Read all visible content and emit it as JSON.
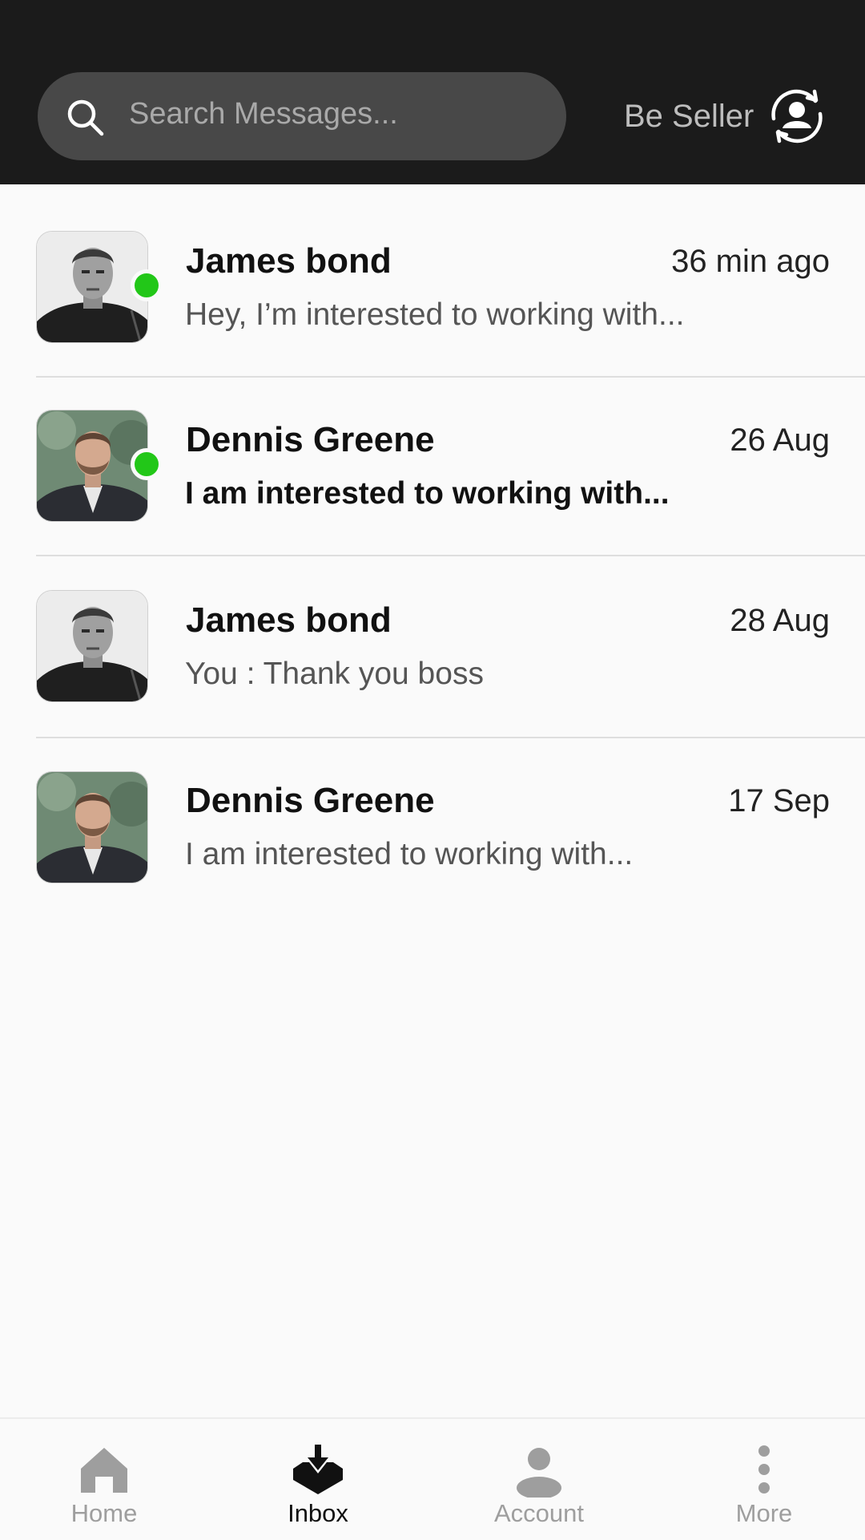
{
  "header": {
    "search_placeholder": "Search Messages...",
    "seller_label": "Be Seller"
  },
  "conversations": [
    {
      "name": "James bond",
      "time": "36 min ago",
      "preview": "Hey, I’m interested to working with...",
      "online": true,
      "unread": false,
      "avatar": "james-bond"
    },
    {
      "name": "Dennis Greene",
      "time": "26 Aug",
      "preview": "I am interested to working with...",
      "online": true,
      "unread": true,
      "avatar": "dennis-greene"
    },
    {
      "name": "James bond",
      "time": "28 Aug",
      "preview": "You : Thank you boss",
      "online": false,
      "unread": false,
      "avatar": "james-bond"
    },
    {
      "name": "Dennis Greene",
      "time": "17 Sep",
      "preview": "I am interested to working with...",
      "online": false,
      "unread": false,
      "avatar": "dennis-greene"
    }
  ],
  "bottom_nav": {
    "items": [
      {
        "label": "Home",
        "icon": "home-icon",
        "active": false
      },
      {
        "label": "Inbox",
        "icon": "inbox-icon",
        "active": true
      },
      {
        "label": "Account",
        "icon": "account-icon",
        "active": false
      },
      {
        "label": "More",
        "icon": "more-icon",
        "active": false
      }
    ]
  },
  "colors": {
    "header_bg": "#1b1b1b",
    "search_bg": "#484848",
    "online": "#22c718",
    "page_bg": "#fafafa"
  }
}
